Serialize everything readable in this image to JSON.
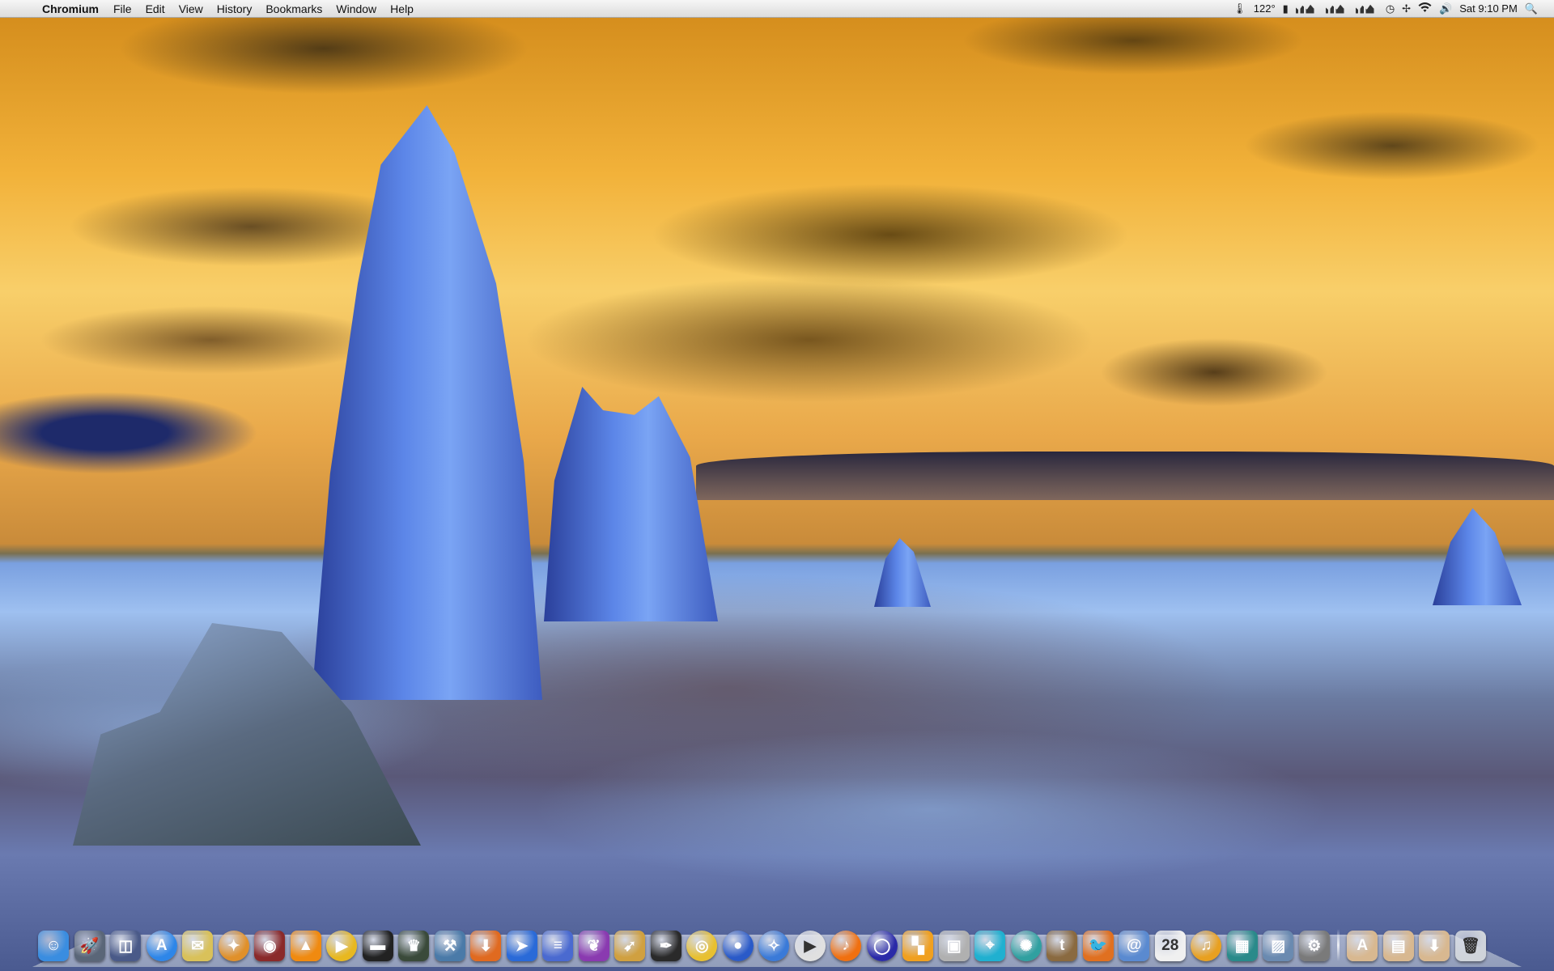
{
  "menubar": {
    "apple_glyph": "",
    "app_name": "Chromium",
    "menus": [
      "File",
      "Edit",
      "View",
      "History",
      "Bookmarks",
      "Window",
      "Help"
    ],
    "status": {
      "temperature": "122°",
      "clock": "Sat 9:10 PM",
      "wifi_icon": "wifi-icon",
      "volume_glyph": "🔊",
      "search_glyph": "🔍"
    }
  },
  "dock": {
    "apps": [
      {
        "name": "finder",
        "glyph": "☺",
        "color": "#3a8de0"
      },
      {
        "name": "launchpad",
        "glyph": "🚀",
        "color": "#5a6678"
      },
      {
        "name": "dashboard",
        "glyph": "◫",
        "color": "#4a5a88"
      },
      {
        "name": "app-store",
        "glyph": "A",
        "color": "#2e86e8"
      },
      {
        "name": "preview",
        "glyph": "✉",
        "color": "#d9c15a"
      },
      {
        "name": "safari",
        "glyph": "✦",
        "color": "#e0902a"
      },
      {
        "name": "photo-booth",
        "glyph": "◉",
        "color": "#8a2a2a"
      },
      {
        "name": "vlc",
        "glyph": "▲",
        "color": "#f08a10"
      },
      {
        "name": "quicktime",
        "glyph": "▶",
        "color": "#e8b820"
      },
      {
        "name": "toggle",
        "glyph": "▬",
        "color": "#222222"
      },
      {
        "name": "alfred",
        "glyph": "♛",
        "color": "#3a4a3a"
      },
      {
        "name": "xcode",
        "glyph": "⚒",
        "color": "#4a7aa8"
      },
      {
        "name": "transmission",
        "glyph": "⬇",
        "color": "#e06a20"
      },
      {
        "name": "mail-pilot",
        "glyph": "➤",
        "color": "#2a6ad8"
      },
      {
        "name": "textedit",
        "glyph": "≡",
        "color": "#4a6ad0"
      },
      {
        "name": "evernote",
        "glyph": "❦",
        "color": "#8a3ab0"
      },
      {
        "name": "cursor-app",
        "glyph": "➹",
        "color": "#d0a040"
      },
      {
        "name": "quill",
        "glyph": "✒",
        "color": "#2a2a2a"
      },
      {
        "name": "chrome",
        "glyph": "◎",
        "color": "#e8c030"
      },
      {
        "name": "firefox",
        "glyph": "●",
        "color": "#2a5ac8"
      },
      {
        "name": "compass",
        "glyph": "✧",
        "color": "#3a7ad8"
      },
      {
        "name": "player",
        "glyph": "▶",
        "color": "#e0e0e0"
      },
      {
        "name": "itunes-radio",
        "glyph": "♪",
        "color": "#f07010"
      },
      {
        "name": "globe",
        "glyph": "◯",
        "color": "#2a2aa8"
      },
      {
        "name": "checker",
        "glyph": "▚",
        "color": "#f0a020"
      },
      {
        "name": "screen-capture",
        "glyph": "▣",
        "color": "#b0b0b0"
      },
      {
        "name": "maps",
        "glyph": "⌖",
        "color": "#20b0d0"
      },
      {
        "name": "bug",
        "glyph": "✺",
        "color": "#30a0a0"
      },
      {
        "name": "tumblr",
        "glyph": "t",
        "color": "#8a6a40"
      },
      {
        "name": "twitter",
        "glyph": "🐦",
        "color": "#e07020"
      },
      {
        "name": "address-book",
        "glyph": "@",
        "color": "#5a8ad0"
      },
      {
        "name": "calendar",
        "glyph": "28",
        "color": "#f0f0f0"
      },
      {
        "name": "itunes",
        "glyph": "♫",
        "color": "#e8a020"
      },
      {
        "name": "stocks",
        "glyph": "▦",
        "color": "#2a8a8a"
      },
      {
        "name": "iphoto",
        "glyph": "▨",
        "color": "#6a8ab0"
      },
      {
        "name": "system-preferences",
        "glyph": "⚙",
        "color": "#7a7a7a"
      }
    ],
    "stacks": [
      {
        "name": "applications-folder",
        "glyph": "A",
        "color": "#d8b890"
      },
      {
        "name": "documents-folder",
        "glyph": "▤",
        "color": "#d8b890"
      },
      {
        "name": "downloads-folder",
        "glyph": "⬇",
        "color": "#d8b890"
      }
    ],
    "trash": {
      "name": "trash",
      "glyph": "🗑",
      "color": "#cfd4da"
    }
  }
}
